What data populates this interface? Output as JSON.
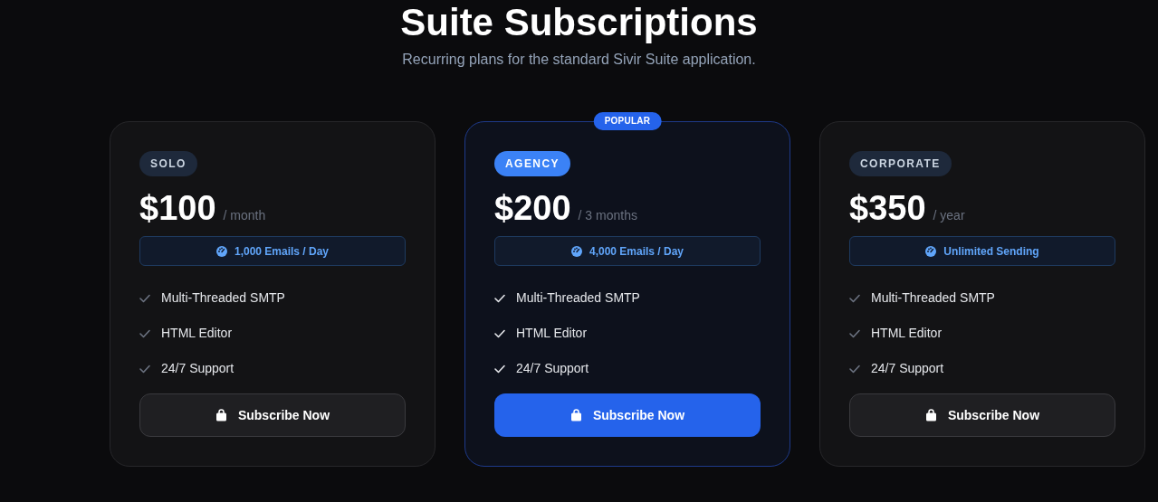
{
  "header": {
    "title": "Suite Subscriptions",
    "subtitle": "Recurring plans for the standard Sivir Suite application."
  },
  "plans": [
    {
      "tag": "SOLO",
      "featured": false,
      "price": "$100",
      "period": "/ month",
      "limit": "1,000 Emails / Day",
      "features": [
        "Multi-Threaded SMTP",
        "HTML Editor",
        "24/7 Support"
      ],
      "button": "Subscribe Now"
    },
    {
      "tag": "AGENCY",
      "featured": true,
      "badge": "POPULAR",
      "price": "$200",
      "period": "/ 3 months",
      "limit": "4,000 Emails / Day",
      "features": [
        "Multi-Threaded SMTP",
        "HTML Editor",
        "24/7 Support"
      ],
      "button": "Subscribe Now"
    },
    {
      "tag": "CORPORATE",
      "featured": false,
      "price": "$350",
      "period": "/ year",
      "limit": "Unlimited Sending",
      "features": [
        "Multi-Threaded SMTP",
        "HTML Editor",
        "24/7 Support"
      ],
      "button": "Subscribe Now"
    }
  ]
}
